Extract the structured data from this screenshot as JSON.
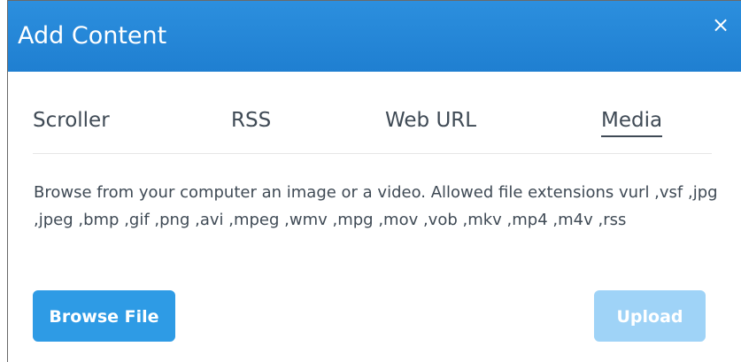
{
  "dialog": {
    "title": "Add Content",
    "close_symbol": "×"
  },
  "tabs": [
    {
      "label": "Scroller",
      "active": false
    },
    {
      "label": "RSS",
      "active": false
    },
    {
      "label": "Web URL",
      "active": false
    },
    {
      "label": "Media",
      "active": true
    }
  ],
  "media": {
    "description": "Browse from your computer an image or a video. Allowed file extensions vurl ,vsf ,jpg ,jpeg ,bmp ,gif ,png ,avi ,mpeg ,wmv ,mpg ,mov ,vob ,mkv ,mp4 ,m4v ,rss",
    "browse_label": "Browse File",
    "upload_label": "Upload",
    "upload_enabled": false
  },
  "colors": {
    "titlebar": "#1f7fd1",
    "primary_button": "#2e9be5",
    "disabled_button": "#9fd3f7",
    "text": "#3f4a55"
  },
  "icons": {
    "close": "close-icon"
  }
}
